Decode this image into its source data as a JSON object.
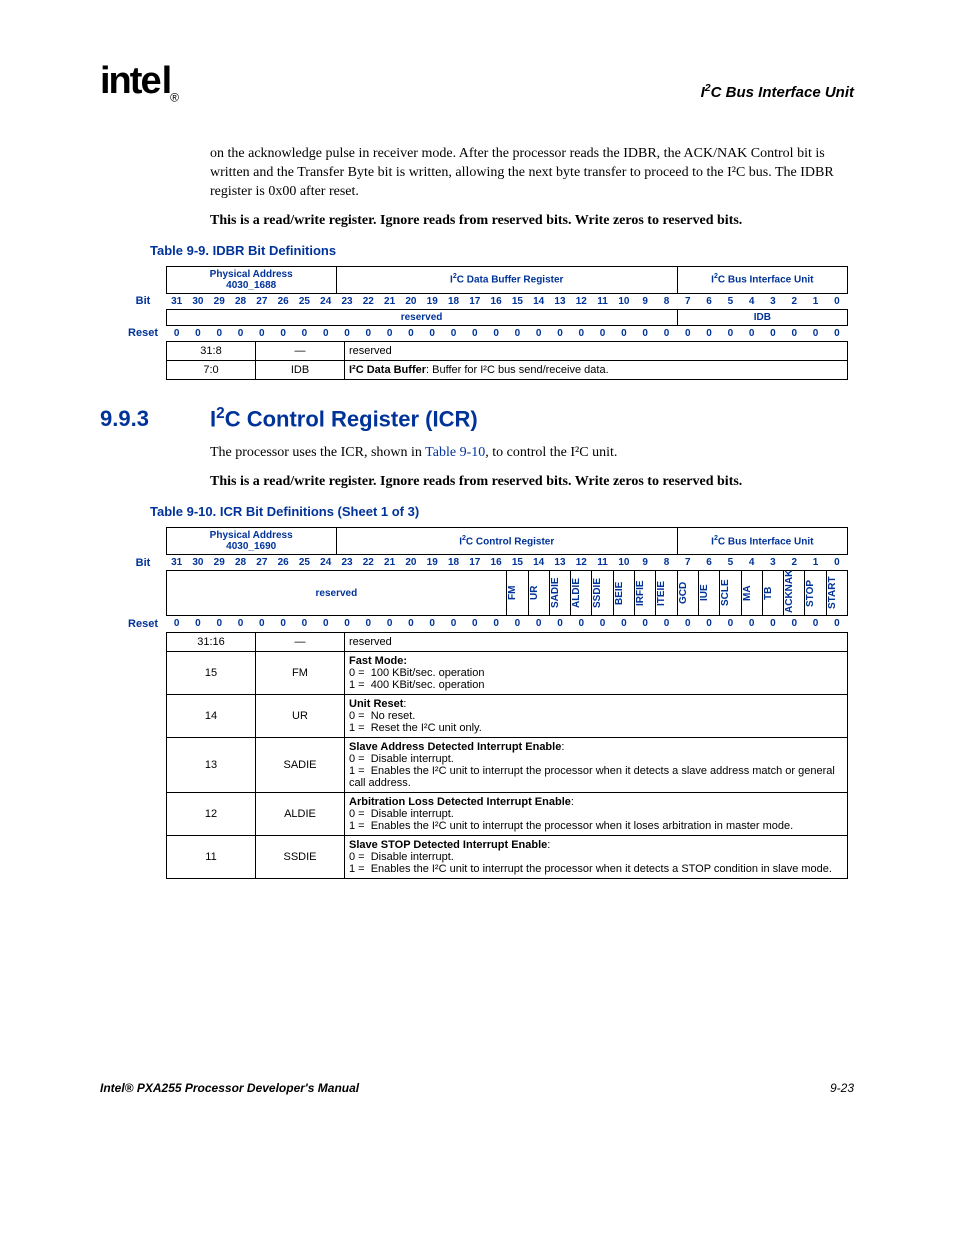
{
  "header": {
    "logo_text": "intel",
    "right": "I²C Bus Interface Unit"
  },
  "paras": {
    "p1": "on the acknowledge pulse in receiver mode. After the processor reads the IDBR, the ACK/NAK Control bit is written and the Transfer Byte bit is written, allowing the next byte transfer to proceed to the I²C bus. The IDBR register is 0x00 after reset.",
    "p2": "This is a read/write register. Ignore reads from reserved bits. Write zeros to reserved bits.",
    "p3": "The processor uses the ICR, shown in ",
    "p3_link": "Table 9-10",
    "p3_end": ", to control the I²C unit.",
    "p4": "This is a read/write register. Ignore reads from reserved bits. Write zeros to reserved bits."
  },
  "table99": {
    "caption": "Table 9-9.  IDBR Bit Definitions",
    "phys_label": "Physical Address",
    "phys_addr": "4030_1688",
    "title": "I²C Data Buffer Register",
    "unit": "I²C Bus Interface Unit",
    "bit_label": "Bit",
    "reset_label": "Reset",
    "bits": [
      "31",
      "30",
      "29",
      "28",
      "27",
      "26",
      "25",
      "24",
      "23",
      "22",
      "21",
      "20",
      "19",
      "18",
      "17",
      "16",
      "15",
      "14",
      "13",
      "12",
      "11",
      "10",
      "9",
      "8",
      "7",
      "6",
      "5",
      "4",
      "3",
      "2",
      "1",
      "0"
    ],
    "fields": {
      "reserved": "reserved",
      "idb": "IDB"
    },
    "reset": [
      "0",
      "0",
      "0",
      "0",
      "0",
      "0",
      "0",
      "0",
      "0",
      "0",
      "0",
      "0",
      "0",
      "0",
      "0",
      "0",
      "0",
      "0",
      "0",
      "0",
      "0",
      "0",
      "0",
      "0",
      "0",
      "0",
      "0",
      "0",
      "0",
      "0",
      "0",
      "0"
    ],
    "rows": [
      {
        "bits": "31:8",
        "name": "—",
        "desc": "reserved"
      },
      {
        "bits": "7:0",
        "name": "IDB",
        "desc_html": "<b>I²C Data Buffer</b>: Buffer for I²C bus send/receive data."
      }
    ]
  },
  "section": {
    "num": "9.9.3",
    "title": "I²C Control Register (ICR)"
  },
  "table910": {
    "caption": "Table 9-10.  ICR Bit Definitions (Sheet 1 of 3)",
    "phys_label": "Physical Address",
    "phys_addr": "4030_1690",
    "title": "I²C Control Register",
    "unit": "I²C Bus Interface Unit",
    "bit_label": "Bit",
    "reset_label": "Reset",
    "bits": [
      "31",
      "30",
      "29",
      "28",
      "27",
      "26",
      "25",
      "24",
      "23",
      "22",
      "21",
      "20",
      "19",
      "18",
      "17",
      "16",
      "15",
      "14",
      "13",
      "12",
      "11",
      "10",
      "9",
      "8",
      "7",
      "6",
      "5",
      "4",
      "3",
      "2",
      "1",
      "0"
    ],
    "reserved": "reserved",
    "fieldnames": [
      "FM",
      "UR",
      "SADIE",
      "ALDIE",
      "SSDIE",
      "BEIE",
      "IRFIE",
      "ITEIE",
      "GCD",
      "IUE",
      "SCLE",
      "MA",
      "TB",
      "ACKNAK",
      "STOP",
      "START"
    ],
    "reset": [
      "0",
      "0",
      "0",
      "0",
      "0",
      "0",
      "0",
      "0",
      "0",
      "0",
      "0",
      "0",
      "0",
      "0",
      "0",
      "0",
      "0",
      "0",
      "0",
      "0",
      "0",
      "0",
      "0",
      "0",
      "0",
      "0",
      "0",
      "0",
      "0",
      "0",
      "0",
      "0"
    ],
    "rows": [
      {
        "bits": "31:16",
        "name": "—",
        "desc": "reserved"
      },
      {
        "bits": "15",
        "name": "FM",
        "desc_html": "<b>Fast Mode:</b><br>0 =&nbsp;&nbsp;100 KBit/sec. operation<br>1 =&nbsp;&nbsp;400 KBit/sec. operation"
      },
      {
        "bits": "14",
        "name": "UR",
        "desc_html": "<b>Unit Reset</b>:<br>0 =&nbsp;&nbsp;No reset.<br>1 =&nbsp;&nbsp;Reset the I²C unit only."
      },
      {
        "bits": "13",
        "name": "SADIE",
        "desc_html": "<b>Slave Address Detected Interrupt Enable</b>:<br>0 =&nbsp;&nbsp;Disable interrupt.<br>1 =&nbsp;&nbsp;Enables the I²C unit to interrupt the processor when it detects a slave address match or general call address."
      },
      {
        "bits": "12",
        "name": "ALDIE",
        "desc_html": "<b>Arbitration Loss Detected Interrupt Enable</b>:<br>0 =&nbsp;&nbsp;Disable interrupt.<br>1 =&nbsp;&nbsp;Enables the I²C unit to interrupt the processor when it loses arbitration in master mode."
      },
      {
        "bits": "11",
        "name": "SSDIE",
        "desc_html": "<b>Slave STOP Detected Interrupt Enable</b>:<br>0 =&nbsp;&nbsp;Disable interrupt.<br>1 =&nbsp;&nbsp;Enables the I²C unit to interrupt the processor when it detects a STOP condition in slave mode."
      }
    ]
  },
  "footer": {
    "left": "Intel® PXA255 Processor Developer's Manual",
    "right": "9-23"
  }
}
